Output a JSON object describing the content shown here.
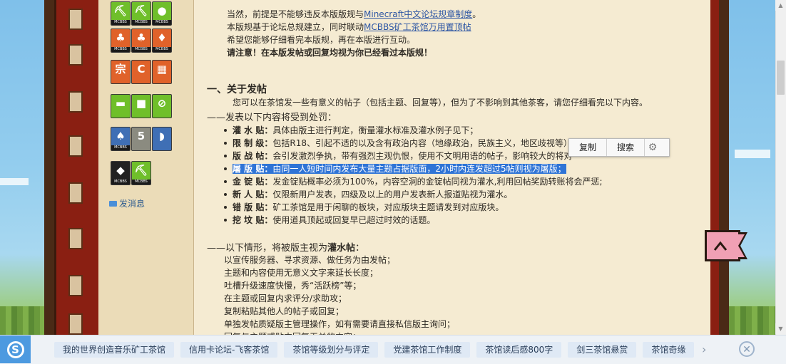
{
  "intro": {
    "line1_prefix": "当然，前提是不能够违反本版版规与",
    "line1_link": "Minecraft中文论坛规章制度",
    "line1_suffix": "。",
    "line2_prefix": "本版规基于论坛总规建立，同时联动",
    "line2_link": "MCBBS矿工茶馆万用置顶帖",
    "line3": "希望您能够仔细看完本版规，再在本版进行互动。",
    "line4": "请注意！在本版发帖或回复均视为你已经看过本版规！"
  },
  "section1": {
    "heading": "一、关于发帖",
    "desc": "您可以在茶馆发一些有意义的帖子（包括主题、回复等），但为了不影响到其他茶客，请您仔细看完以下内容。",
    "subheading": "——发表以下内容将受到处罚：",
    "items": [
      {
        "term": "灌 水 贴：",
        "text": "具体由版主进行判定，衡量灌水标准及灌水例子见下；"
      },
      {
        "term": "限 制 级：",
        "text": "包括R18、引起不适的以及含有政治内容（地缘政治，民族主义，地区歧视等）"
      },
      {
        "term": "版 战 帖：",
        "text": "会引发激烈争执，带有强烈主观仇恨，使用不文明用语的帖子，影响较大的将对"
      },
      {
        "term": "屠 版 贴：",
        "text": "由同一人短时间内发布大量主题占据版面，2小时内连发超过5帖则视为屠版；"
      },
      {
        "term": "金 锭 贴：",
        "text": "发金锭贴概率必须为100%，内容空洞的金锭帖同视为灌水,利用回帖奖励转账将会严惩;"
      },
      {
        "term": "新 人 贴：",
        "text": "仅限新用户发表，四级及以上的用户发表新人报道贴视为灌水。"
      },
      {
        "term": "错 版 贴：",
        "text": "矿工茶馆是用于闲聊的板块，对应版块主题请发到对应版块。"
      },
      {
        "term": "挖 坟 贴：",
        "text": "使用道具顶起或回复早已超过时效的话题。"
      }
    ]
  },
  "section2": {
    "heading_prefix": "——以下情形，将被版主视为",
    "heading_bold": "灌水帖",
    "heading_suffix": "：",
    "lines": [
      "以宣传服务器、寻求资源、做任务为由发帖；",
      "主题和内容使用无意义文字来延长长度；",
      "吐槽升级速度快慢，秀“活跃榜”等；",
      "在主题或回复内求评分/求助攻；",
      "复制粘贴其他人的帖子或回复；",
      "单独发帖质疑版主管理操作，如有需要请直接私信版主询问；",
      "回复与主题或贴内回复无关的内容；"
    ]
  },
  "sidebar": {
    "send_message": "发消息",
    "medals": [
      {
        "icon": "pickaxe-medal-icon",
        "glyph": "⛏",
        "color": "green",
        "tag": "MCBBS"
      },
      {
        "icon": "pickaxe-medal-icon",
        "glyph": "⛏",
        "color": "green",
        "tag": "MCBBS"
      },
      {
        "icon": "apple-medal-icon",
        "glyph": "●",
        "color": "green",
        "tag": "MCBBS"
      },
      {
        "icon": "plant-medal-icon",
        "glyph": "♣",
        "color": "orange",
        "tag": "MCBBS"
      },
      {
        "icon": "plant-medal-icon",
        "glyph": "♣",
        "color": "orange",
        "tag": "MCBBS"
      },
      {
        "icon": "redstone-medal-icon",
        "glyph": "♦",
        "color": "orange",
        "tag": "MCBBS"
      },
      {
        "icon": "hanzi-medal-icon",
        "glyph": "宗",
        "color": "orange",
        "tag": ""
      },
      {
        "icon": "c-logo-medal-icon",
        "glyph": "C",
        "color": "orange",
        "tag": ""
      },
      {
        "icon": "grid-medal-icon",
        "glyph": "▦",
        "color": "orange",
        "tag": ""
      },
      {
        "icon": "gold-ingot-medal-icon",
        "glyph": "▬",
        "color": "green",
        "tag": ""
      },
      {
        "icon": "sponge-block-medal-icon",
        "glyph": "■",
        "color": "green",
        "tag": ""
      },
      {
        "icon": "no-tnt-medal-icon",
        "glyph": "⊘",
        "color": "green",
        "tag": ""
      },
      {
        "icon": "tree-medal-icon",
        "glyph": "♠",
        "color": "blue",
        "tag": "MCBBS"
      },
      {
        "icon": "badge-5-medal-icon",
        "glyph": "5",
        "color": "gray",
        "tag": ""
      },
      {
        "icon": "bread-medal-icon",
        "glyph": "◗",
        "color": "blue",
        "tag": ""
      },
      {
        "icon": "ore-medal-icon",
        "glyph": "◆",
        "color": "black",
        "tag": "MCBBS"
      },
      {
        "icon": "diamond-pickaxe-medal-icon",
        "glyph": "⛏",
        "color": "green",
        "tag": "MCBBS"
      }
    ]
  },
  "popup": {
    "copy": "复制",
    "search": "搜索"
  },
  "bottom_bar": {
    "chips": [
      "我的世界创造音乐矿工茶馆",
      "信用卡论坛-飞客茶馆",
      "茶馆等级划分与评定",
      "党建茶馆工作制度",
      "茶馆读后感800字",
      "剑三茶馆悬赏",
      "茶馆奇缘"
    ]
  },
  "colors": {
    "accent_link": "#2d56a4",
    "highlight": "#2f74d6",
    "book_red": "#8a1f12",
    "page_bg": "#f5ebd2"
  }
}
